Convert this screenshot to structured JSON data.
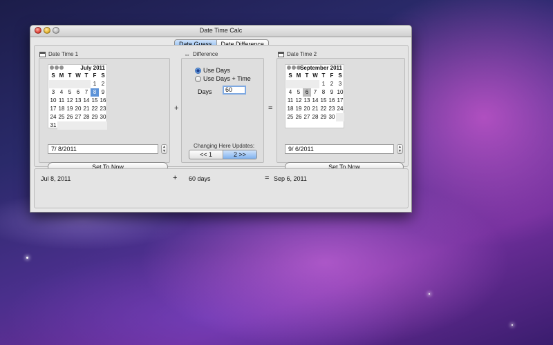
{
  "window": {
    "title": "Date Time Calc"
  },
  "tabs": [
    {
      "label": "Date Guess",
      "active": true
    },
    {
      "label": "Date Difference",
      "active": false
    }
  ],
  "left": {
    "label": "Date Time 1",
    "calendar": {
      "month": "July 2011",
      "dow": [
        "S",
        "M",
        "T",
        "W",
        "T",
        "F",
        "S"
      ],
      "cells": [
        "",
        "",
        "",
        "",
        "",
        "1",
        "2",
        "3",
        "4",
        "5",
        "6",
        "7",
        "8",
        "9",
        "10",
        "11",
        "12",
        "13",
        "14",
        "15",
        "16",
        "17",
        "18",
        "19",
        "20",
        "21",
        "22",
        "23",
        "24",
        "25",
        "26",
        "27",
        "28",
        "29",
        "30",
        "31",
        "",
        "",
        "",
        "",
        "",
        ""
      ],
      "selected": "8"
    },
    "date_value": "7/  8/2011",
    "set_now": "Set To Now"
  },
  "middle": {
    "label": "Difference",
    "radio_days": "Use Days",
    "radio_days_time": "Use Days + Time",
    "days_label": "Days",
    "days_value": "60",
    "updates_label": "Changing Here Updates:",
    "seg_left": "<< 1",
    "seg_right": "2 >>"
  },
  "right": {
    "label": "Date Time 2",
    "calendar": {
      "month": "September 2011",
      "dow": [
        "S",
        "M",
        "T",
        "W",
        "T",
        "F",
        "S"
      ],
      "cells": [
        "",
        "",
        "",
        "",
        "1",
        "2",
        "3",
        "4",
        "5",
        "6",
        "7",
        "8",
        "9",
        "10",
        "11",
        "12",
        "13",
        "14",
        "15",
        "16",
        "17",
        "18",
        "19",
        "20",
        "21",
        "22",
        "23",
        "24",
        "25",
        "26",
        "27",
        "28",
        "29",
        "30",
        ""
      ],
      "selected": "6"
    },
    "date_value": "9/  6/2011",
    "set_now": "Set To Now"
  },
  "ops": {
    "plus": "+",
    "equals": "="
  },
  "result": {
    "date1": "Jul 8, 2011",
    "plus": "+",
    "diff": "60 days",
    "equals": "=",
    "date2": "Sep 6, 2011"
  }
}
